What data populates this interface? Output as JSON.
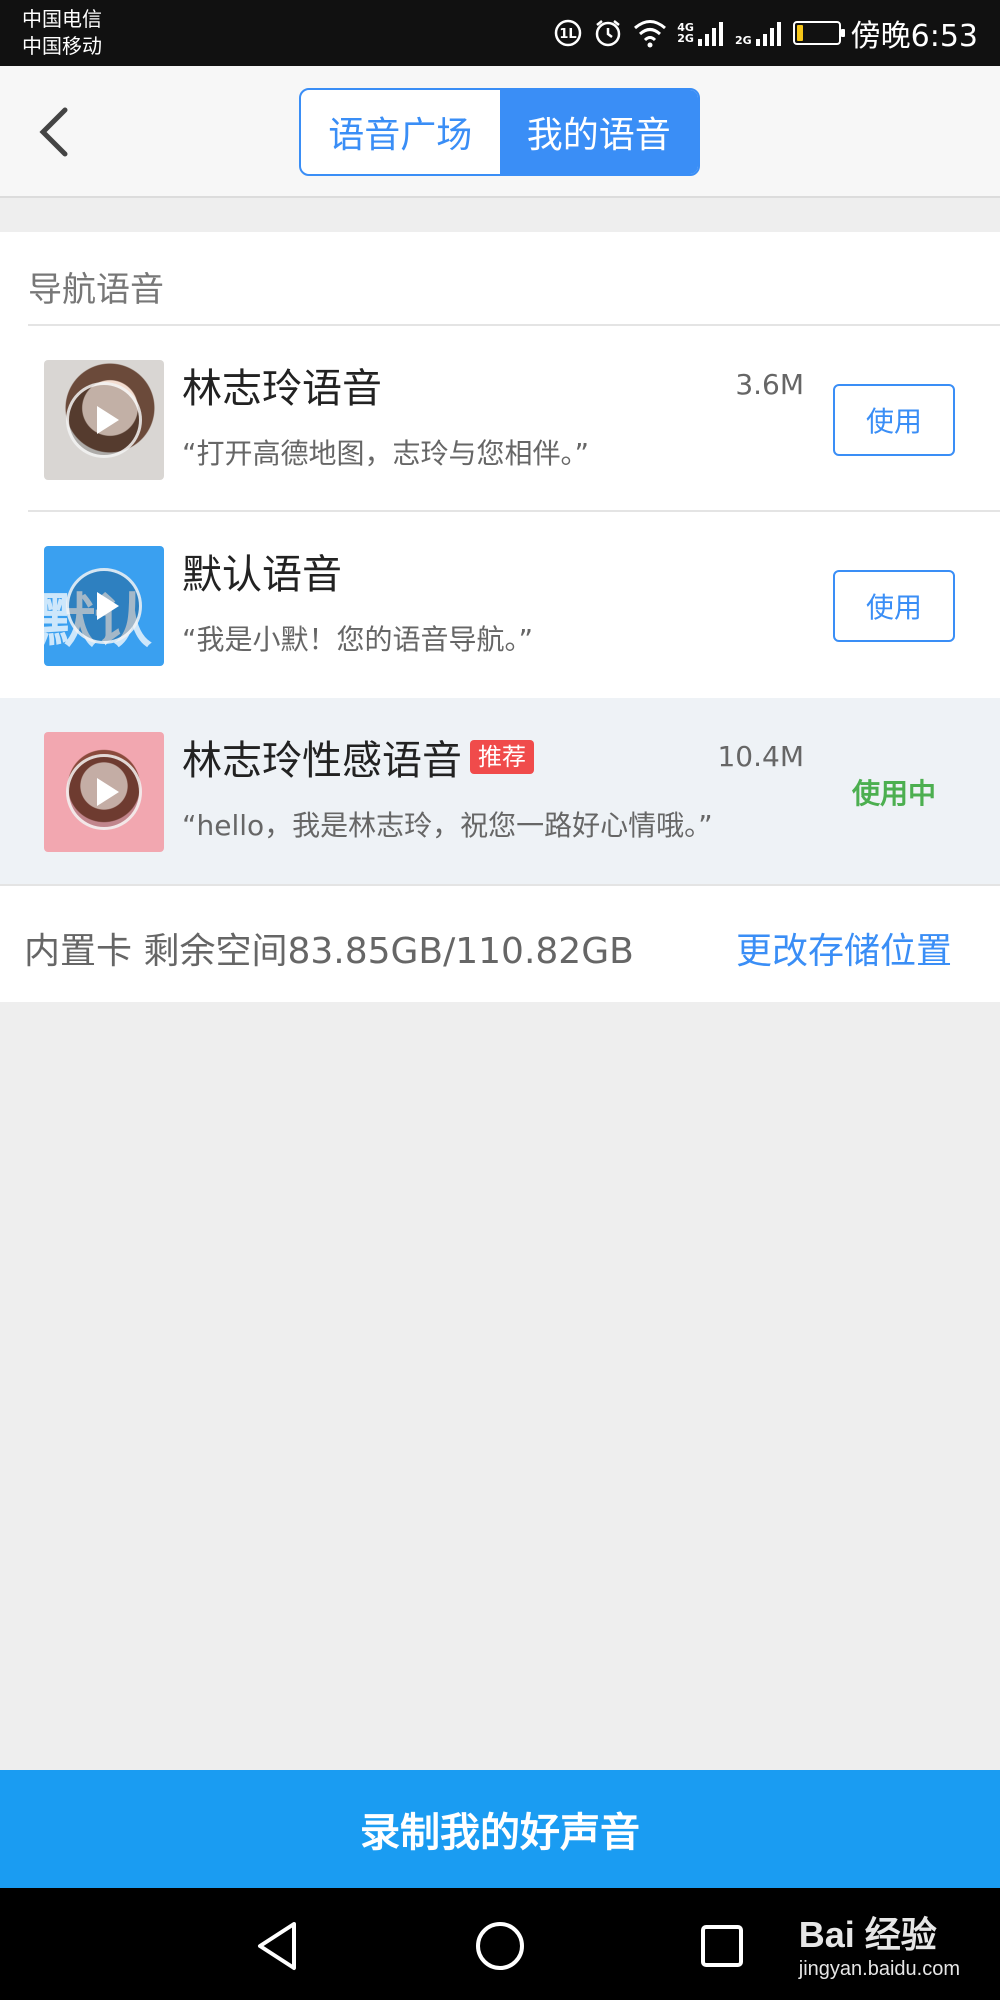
{
  "status_bar": {
    "carrier_1": "中国电信",
    "carrier_2": "中国移动",
    "signal_1_label": "4G\n2G",
    "signal_2_label": "2G",
    "battery_level": 0.15,
    "time": "傍晚6:53",
    "icons": [
      "hd-call-icon",
      "alarm-icon",
      "wifi-icon",
      "signal-icon",
      "signal-icon",
      "battery-icon"
    ]
  },
  "header": {
    "back_icon": "chevron-left-icon",
    "tabs": [
      {
        "label": "语音广场",
        "active": false
      },
      {
        "label": "我的语音",
        "active": true
      }
    ]
  },
  "section": {
    "title": "导航语音"
  },
  "voices": [
    {
      "name": "林志玲语音",
      "size": "3.6M",
      "desc": "“打开高德地图，志玲与您相伴。”",
      "action": "使用",
      "badge": "",
      "thumb": "woman-portrait-thumb"
    },
    {
      "name": "默认语音",
      "size": "",
      "desc": "“我是小默！您的语音导航。”",
      "action": "使用",
      "badge": "",
      "thumb": "default-voice-thumb",
      "thumb_text": "默认"
    },
    {
      "name": "林志玲性感语音",
      "size": "10.4M",
      "desc": "“hello，我是林志玲，祝您一路好心情哦。”",
      "action": "使用中",
      "badge": "推荐",
      "thumb": "woman-portrait-pink-thumb"
    }
  ],
  "storage": {
    "text": "内置卡 剩余空间83.85GB/110.82GB",
    "change_link": "更改存储位置"
  },
  "record_button": "录制我的好声音",
  "nav_bar": {
    "icons": [
      "back-triangle-icon",
      "home-circle-icon",
      "recents-square-icon"
    ]
  },
  "watermark": {
    "logo": "Bai 经验",
    "url": "jingyan.baidu.com"
  },
  "colors": {
    "accent": "#3a8ef6",
    "record_bg": "#1a9cf2",
    "in_use": "#4caf50",
    "badge": "#f04b4b"
  }
}
